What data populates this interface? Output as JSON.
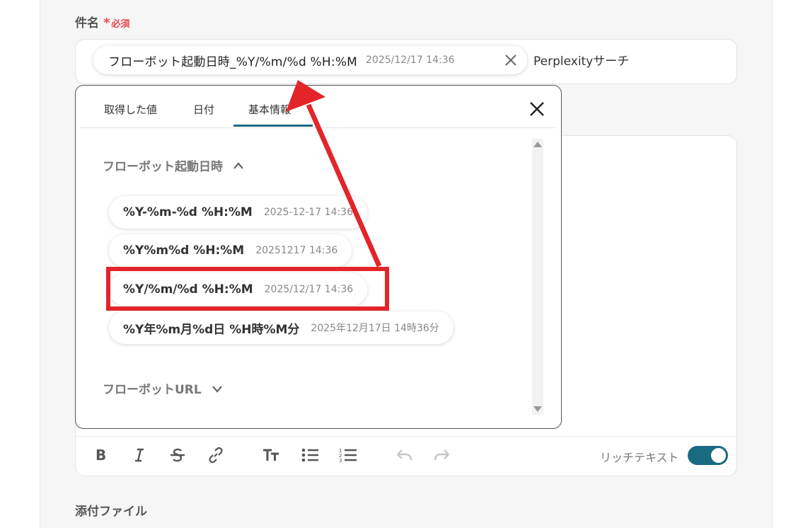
{
  "form": {
    "subject_label": "件名",
    "required_star": "*",
    "required_text": "必須",
    "subject_chip": {
      "key": "フローボット起動日時_%Y/%m/%d %H:%M",
      "value": "2025/12/17 14:36"
    },
    "subject_suffix": "Perplexityサーチ",
    "attachment_label": "添付ファイル",
    "rich_text_label": "リッチテキスト",
    "rich_text_enabled": true
  },
  "popup": {
    "tabs": [
      {
        "label": "取得した値",
        "active": false
      },
      {
        "label": "日付",
        "active": false
      },
      {
        "label": "基本情報",
        "active": true
      }
    ],
    "sections": [
      {
        "title": "フローボット起動日時",
        "expanded": true,
        "options": [
          {
            "key": "%Y-%m-%d %H:%M",
            "value": "2025-12-17 14:36"
          },
          {
            "key": "%Y%m%d %H:%M",
            "value": "20251217 14:36"
          },
          {
            "key": "%Y/%m/%d %H:%M",
            "value": "2025/12/17 14:36",
            "highlighted": true
          },
          {
            "key": "%Y年%m月%d日 %H時%M分",
            "value": "2025年12月17日 14時36分"
          }
        ]
      },
      {
        "title": "フローボットURL",
        "expanded": false
      }
    ]
  },
  "colors": {
    "accent": "#1a6b82",
    "annotation": "#e3252a",
    "required": "#e5484d"
  },
  "icons": [
    "close-icon",
    "chevron-up-icon",
    "chevron-down-icon",
    "bold-icon",
    "italic-icon",
    "strikethrough-icon",
    "link-icon",
    "heading-icon",
    "bullet-list-icon",
    "numbered-list-icon",
    "undo-icon",
    "redo-icon"
  ]
}
